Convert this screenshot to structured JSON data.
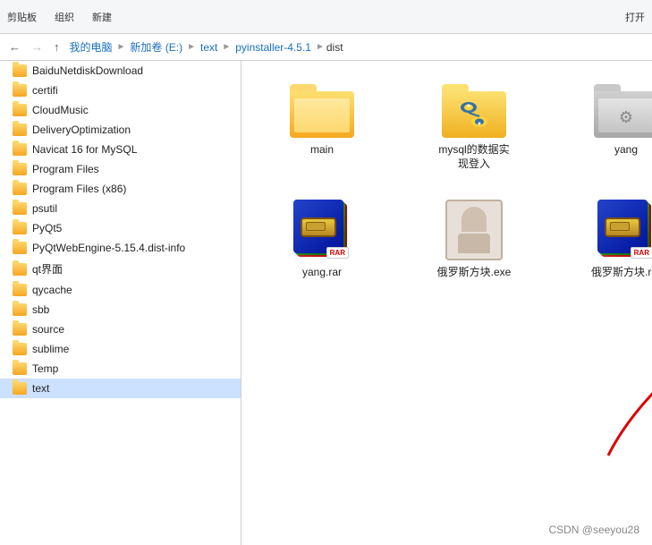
{
  "toolbar": {
    "groups": [
      {
        "label": "剪贴板"
      },
      {
        "label": "组织"
      },
      {
        "label": "新建"
      },
      {
        "label": "打开"
      }
    ]
  },
  "breadcrumb": {
    "items": [
      {
        "label": "我的电脑"
      },
      {
        "label": "新加卷 (E:)"
      },
      {
        "label": "text"
      },
      {
        "label": "pyinstaller-4.5.1"
      },
      {
        "label": "dist"
      }
    ]
  },
  "sidebar": {
    "items": [
      {
        "label": "BaiduNetdiskDownload"
      },
      {
        "label": "certifi"
      },
      {
        "label": "CloudMusic"
      },
      {
        "label": "DeliveryOptimization"
      },
      {
        "label": "Navicat 16 for MySQL"
      },
      {
        "label": "Program Files"
      },
      {
        "label": "Program Files (x86)"
      },
      {
        "label": "psutil"
      },
      {
        "label": "PyQt5"
      },
      {
        "label": "PyQtWebEngine-5.15.4.dist-info"
      },
      {
        "label": "qt界面"
      },
      {
        "label": "qycache"
      },
      {
        "label": "sbb"
      },
      {
        "label": "source"
      },
      {
        "label": "sublime"
      },
      {
        "label": "Temp"
      },
      {
        "label": "text"
      }
    ],
    "active_index": 16
  },
  "files": {
    "folders": [
      {
        "id": "main",
        "label": "main",
        "type": "plain"
      },
      {
        "id": "mysql",
        "label": "mysql的数据实\n现登入",
        "type": "python"
      },
      {
        "id": "yang",
        "label": "yang",
        "type": "gear"
      }
    ],
    "archives": [
      {
        "id": "yang_rar",
        "label": "yang.rar",
        "type": "rar"
      },
      {
        "id": "exe_file",
        "label": "俄罗斯方块.exe",
        "type": "exe"
      },
      {
        "id": "rar_file",
        "label": "俄罗斯方块.rar",
        "type": "rar"
      }
    ]
  },
  "watermark": "CSDN @seeyou28"
}
